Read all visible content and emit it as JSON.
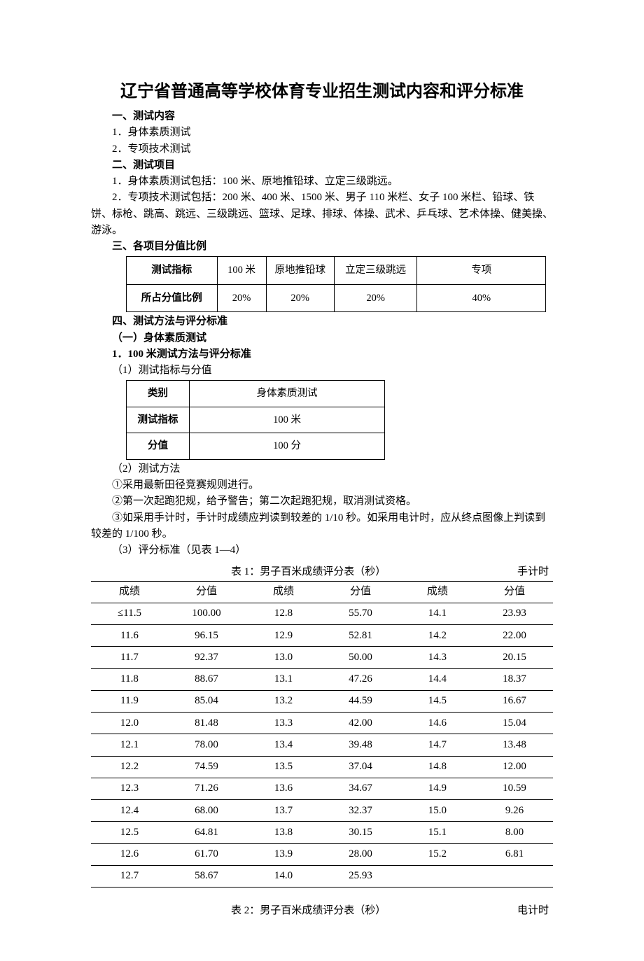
{
  "title": "辽宁省普通高等学校体育专业招生测试内容和评分标准",
  "sec1": {
    "h": "一、测试内容",
    "i1": "1．身体素质测试",
    "i2": "2．专项技术测试"
  },
  "sec2": {
    "h": "二、测试项目",
    "p1": "1．身体素质测试包括：100 米、原地推铅球、立定三级跳远。",
    "p2": "2．专项技术测试包括：200 米、400 米、1500 米、男子 110 米栏、女子 100 米栏、铅球、铁饼、标枪、跳高、跳远、三级跳远、篮球、足球、排球、体操、武术、乒乓球、艺术体操、健美操、游泳。"
  },
  "sec3": {
    "h": "三、各项目分值比例",
    "table": {
      "row1": {
        "lbl": "测试指标",
        "c1": "100 米",
        "c2": "原地推铅球",
        "c3": "立定三级跳远",
        "c4": "专项"
      },
      "row2": {
        "lbl": "所占分值比例",
        "c1": "20%",
        "c2": "20%",
        "c3": "20%",
        "c4": "40%"
      }
    }
  },
  "sec4": {
    "h": "四、测试方法与评分标准",
    "sub1": "（一）身体素质测试",
    "sub2": "1．100 米测试方法与评分标准",
    "sub3": "（1）测试指标与分值",
    "cat": {
      "r1l": "类别",
      "r1v": "身体素质测试",
      "r2l": "测试指标",
      "r2v": "100 米",
      "r3l": "分值",
      "r3v": "100 分"
    },
    "method_h": "（2）测试方法",
    "m1": "①采用最新田径竞赛规则进行。",
    "m2": "②第一次起跑犯规，给予警告；第二次起跑犯规，取消测试资格。",
    "m3": "③如采用手计时，手计时成绩应判读到较差的 1/10 秒。如采用电计时，应从终点图像上判读到较差的 1/100 秒。",
    "std_h": "（3）评分标准（见表 1—4）",
    "t1_title": "表 1：男子百米成绩评分表（秒）",
    "t1_mode": "手计时",
    "t1_cols": {
      "a": "成绩",
      "b": "分值"
    },
    "t2_title": "表 2：男子百米成绩评分表（秒）",
    "t2_mode": "电计时"
  },
  "chart_data": {
    "type": "table",
    "title": "表 1：男子百米成绩评分表（秒） — 手计时",
    "columns": [
      "成绩",
      "分值",
      "成绩",
      "分值",
      "成绩",
      "分值"
    ],
    "rows": [
      [
        "≤11.5",
        "100.00",
        "12.8",
        "55.70",
        "14.1",
        "23.93"
      ],
      [
        "11.6",
        "96.15",
        "12.9",
        "52.81",
        "14.2",
        "22.00"
      ],
      [
        "11.7",
        "92.37",
        "13.0",
        "50.00",
        "14.3",
        "20.15"
      ],
      [
        "11.8",
        "88.67",
        "13.1",
        "47.26",
        "14.4",
        "18.37"
      ],
      [
        "11.9",
        "85.04",
        "13.2",
        "44.59",
        "14.5",
        "16.67"
      ],
      [
        "12.0",
        "81.48",
        "13.3",
        "42.00",
        "14.6",
        "15.04"
      ],
      [
        "12.1",
        "78.00",
        "13.4",
        "39.48",
        "14.7",
        "13.48"
      ],
      [
        "12.2",
        "74.59",
        "13.5",
        "37.04",
        "14.8",
        "12.00"
      ],
      [
        "12.3",
        "71.26",
        "13.6",
        "34.67",
        "14.9",
        "10.59"
      ],
      [
        "12.4",
        "68.00",
        "13.7",
        "32.37",
        "15.0",
        "9.26"
      ],
      [
        "12.5",
        "64.81",
        "13.8",
        "30.15",
        "15.1",
        "8.00"
      ],
      [
        "12.6",
        "61.70",
        "13.9",
        "28.00",
        "15.2",
        "6.81"
      ],
      [
        "12.7",
        "58.67",
        "14.0",
        "25.93",
        "",
        ""
      ]
    ]
  }
}
